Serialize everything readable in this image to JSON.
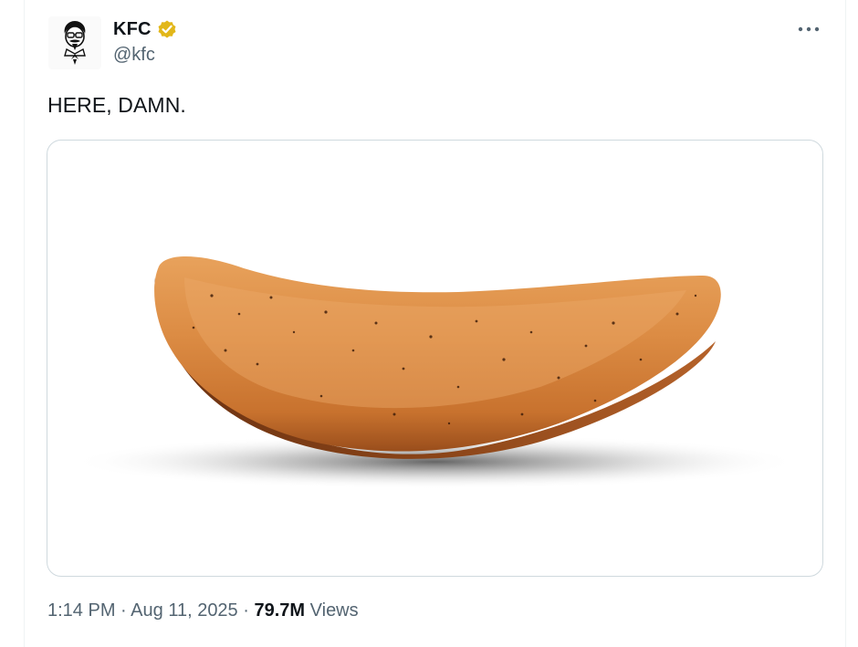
{
  "tweet": {
    "author": {
      "display_name": "KFC",
      "handle": "@kfc",
      "verified": true,
      "verified_color": "#e2b719",
      "avatar_icon": "colonel-sanders-logo-icon"
    },
    "text": "HERE, DAMN.",
    "media": {
      "icon": "potato-wedge-image"
    },
    "meta": {
      "time": "1:14 PM",
      "separator": "·",
      "date": "Aug 11, 2025",
      "views_count": "79.7M",
      "views_label": "Views"
    },
    "more_icon": "more-horizontal-icon"
  }
}
